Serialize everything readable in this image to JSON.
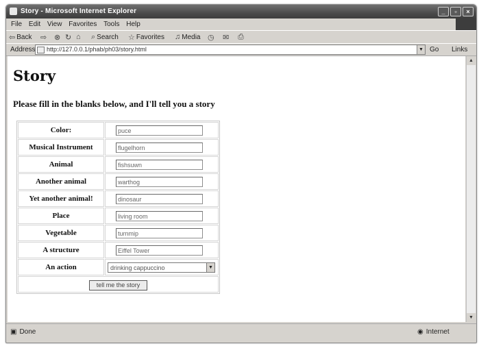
{
  "window": {
    "title": "Story - Microsoft Internet Explorer",
    "min_label": "_",
    "max_label": "▫",
    "close_label": "×"
  },
  "menu": [
    "File",
    "Edit",
    "View",
    "Favorites",
    "Tools",
    "Help"
  ],
  "toolbar": {
    "back": "Back",
    "forward": "⇨",
    "stop": "⊗",
    "refresh": "↻",
    "home": "⌂",
    "search": "Search",
    "favorites": "Favorites",
    "media": "Media",
    "history": "◷",
    "mail": "✉",
    "print": "⎙"
  },
  "address": {
    "label": "Address",
    "url": "http://127.0.0.1/phab/ph03/story.html",
    "go": "Go",
    "links": "Links"
  },
  "page": {
    "heading": "Story",
    "subheading": "Please fill in the blanks below, and I'll tell you a story"
  },
  "form": {
    "fields": [
      {
        "label": "Color:",
        "value": "puce"
      },
      {
        "label": "Musical Instrument",
        "value": "flugelhorn"
      },
      {
        "label": "Animal",
        "value": "fishsuwn"
      },
      {
        "label": "Another animal",
        "value": "warthog"
      },
      {
        "label": "Yet another animal!",
        "value": "dinosaur"
      },
      {
        "label": "Place",
        "value": "living room"
      },
      {
        "label": "Vegetable",
        "value": "turnmip"
      },
      {
        "label": "A structure",
        "value": "Eiffel Tower"
      }
    ],
    "action": {
      "label": "An action",
      "selected": "drinking cappuccino"
    },
    "submit_label": "tell me the story"
  },
  "status": {
    "left": "Done",
    "zone": "Internet"
  }
}
